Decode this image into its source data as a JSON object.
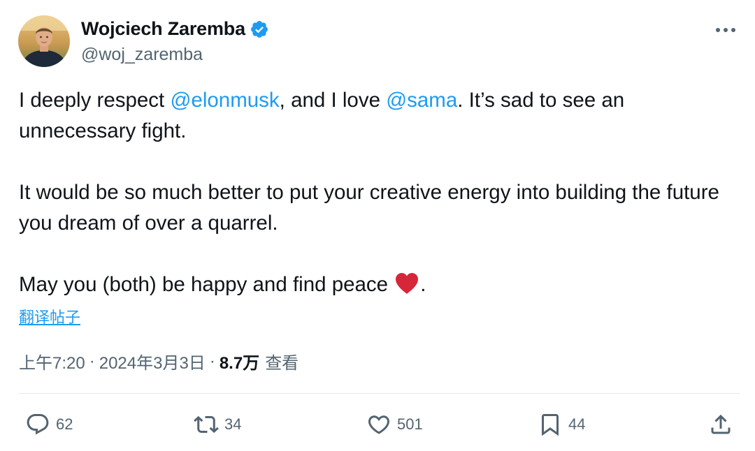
{
  "author": {
    "display_name": "Wojciech Zaremba",
    "handle": "@woj_zaremba",
    "verified": true
  },
  "tweet": {
    "p1_before": "I deeply respect ",
    "mention1": "@elonmusk",
    "p1_middle": ", and I love ",
    "mention2": "@sama",
    "p1_after": ". It’s sad to see an unnecessary fight.",
    "p2": "It would be so much better to put your creative energy into building the future you dream of over a quarrel.",
    "p3_before": "May you (both) be happy and find peace ",
    "p3_after": "."
  },
  "translate_label": "翻译帖子",
  "meta": {
    "time": "上午7:20",
    "separator": "·",
    "date": "2024年3月3日",
    "views_count": "8.7万",
    "views_label": "查看"
  },
  "actions": {
    "reply_count": "62",
    "retweet_count": "34",
    "like_count": "501",
    "bookmark_count": "44"
  },
  "icons": {
    "verified": "verified-badge-icon",
    "more": "more-horizontal-icon",
    "reply": "reply-icon",
    "retweet": "retweet-icon",
    "like": "heart-icon",
    "bookmark": "bookmark-icon",
    "share": "share-icon",
    "emoji": "red-heart-emoji"
  },
  "colors": {
    "accent": "#1d9bf0",
    "text": "#0f1419",
    "secondary": "#536471",
    "heart_emoji": "#d6263a"
  }
}
